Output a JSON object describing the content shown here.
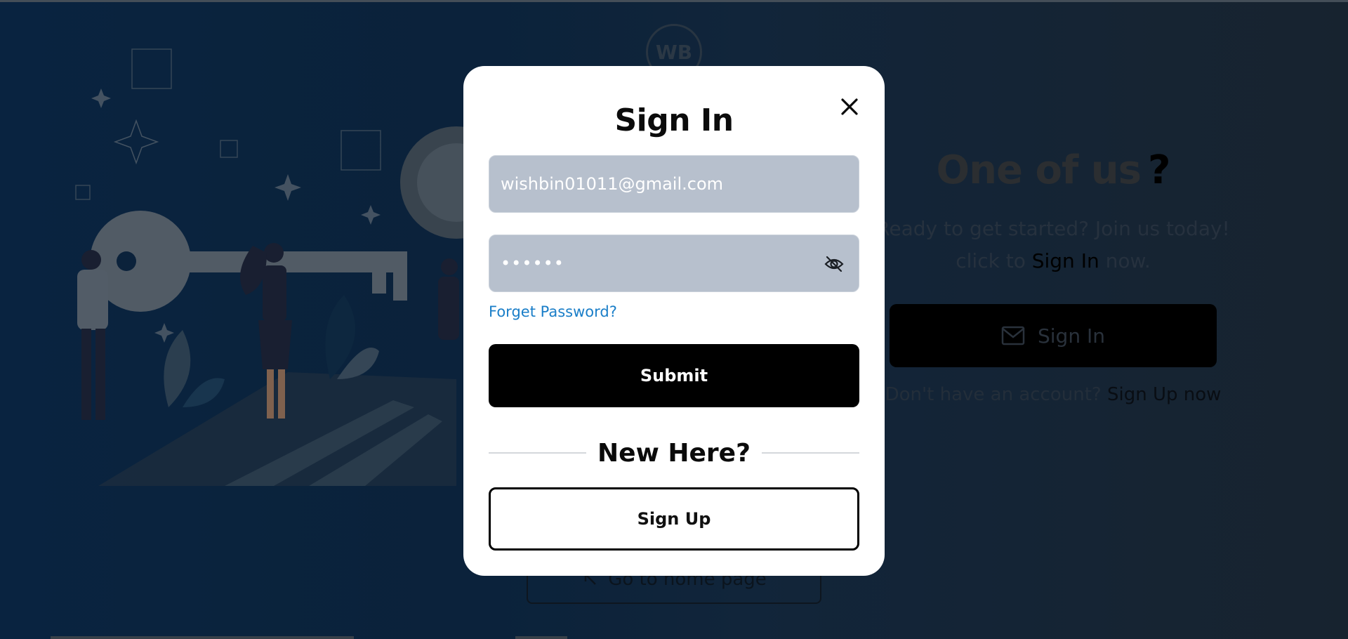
{
  "background": {
    "logo_text": "WB",
    "hero": {
      "title": "One of us",
      "title_mark": "?",
      "subtitle_line1": "Ready to get started? Join us today!",
      "subtitle_prefix": "click to",
      "subtitle_link": "Sign In",
      "subtitle_suffix": "now.",
      "signin_label": "Sign In",
      "account_text": "Don't have an account?",
      "signup_link": "Sign Up now"
    },
    "home_button_label": "Go to home page"
  },
  "modal": {
    "title": "Sign In",
    "email_value": "wishbin01011@gmail.com",
    "password_mask": "••••••",
    "forget_password": "Forget Password?",
    "submit_label": "Submit",
    "divider_text": "New Here?",
    "signup_label": "Sign Up"
  },
  "icons": {
    "close": "close-icon",
    "password_toggle": "eye-off-icon",
    "mail": "mail-icon",
    "home": "arrow-icon"
  },
  "colors": {
    "accent_link": "#1a7ec8",
    "input_bg": "#b7c0cd",
    "primary_button": "#000000"
  }
}
